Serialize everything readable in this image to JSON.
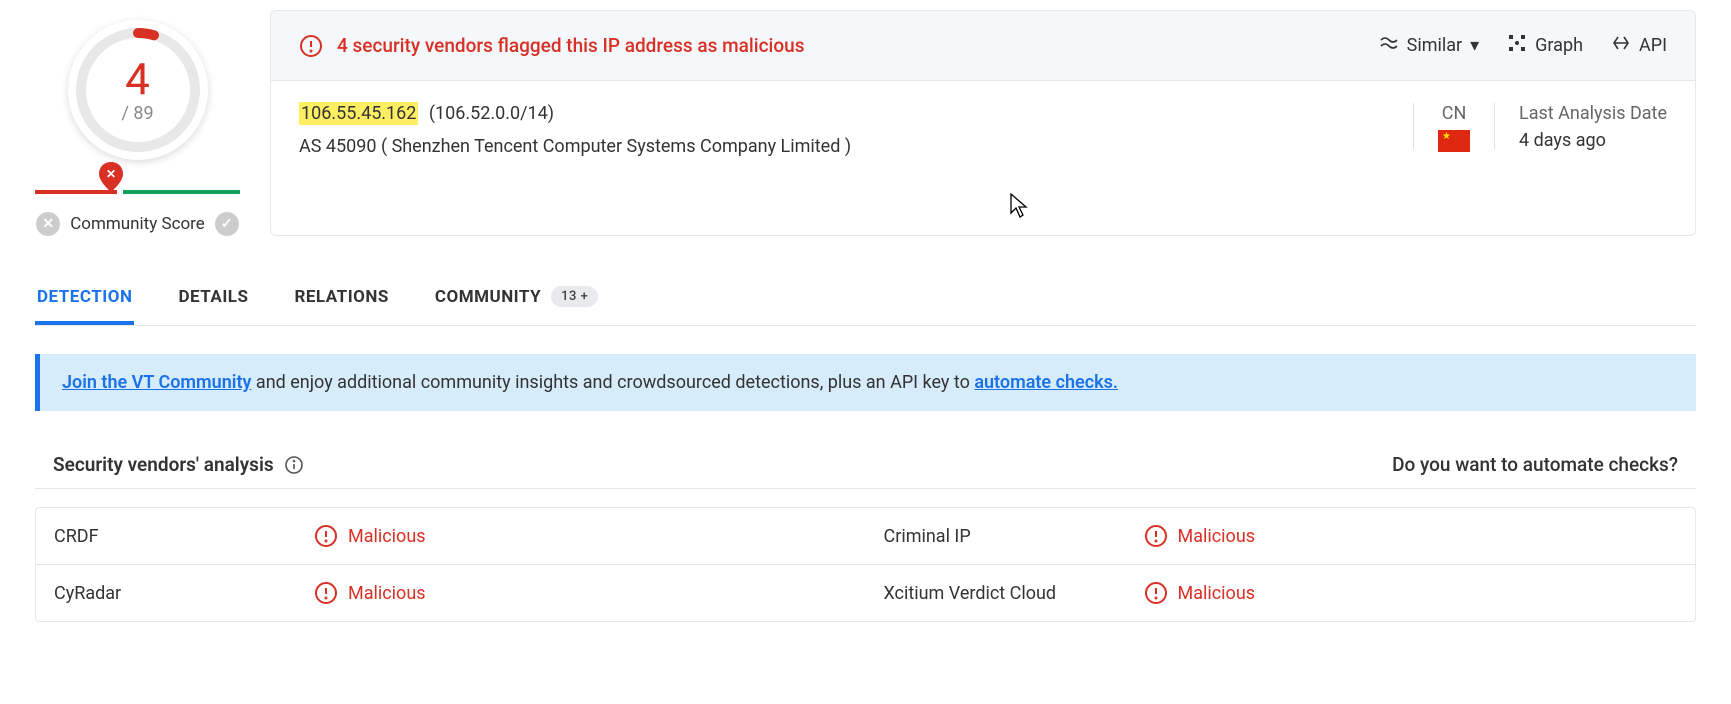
{
  "score": {
    "flagged": "4",
    "total": "/ 89",
    "community_label": "Community Score"
  },
  "summary": {
    "alert_text": "4 security vendors flagged this IP address as malicious",
    "actions": {
      "similar": "Similar",
      "graph": "Graph",
      "api": "API"
    },
    "ip": "106.55.45.162",
    "ip_range": "(106.52.0.0/14)",
    "as_line": "AS 45090  ( Shenzhen Tencent Computer Systems Company Limited )",
    "country_code": "CN",
    "analysis_label": "Last Analysis Date",
    "analysis_value": "4 days ago"
  },
  "tabs": {
    "detection": "DETECTION",
    "details": "DETAILS",
    "relations": "RELATIONS",
    "community": "COMMUNITY",
    "community_badge": "13 +"
  },
  "promo": {
    "link1": "Join the VT Community",
    "mid": " and enjoy additional community insights and crowdsourced detections, plus an API key to ",
    "link2": "automate checks.",
    "after": ""
  },
  "vendors": {
    "title": "Security vendors' analysis",
    "automate": "Do you want to automate checks?",
    "rows": [
      {
        "left_name": "CRDF",
        "left_verdict": "Malicious",
        "right_name": "Criminal IP",
        "right_verdict": "Malicious"
      },
      {
        "left_name": "CyRadar",
        "left_verdict": "Malicious",
        "right_name": "Xcitium Verdict Cloud",
        "right_verdict": "Malicious"
      }
    ]
  }
}
